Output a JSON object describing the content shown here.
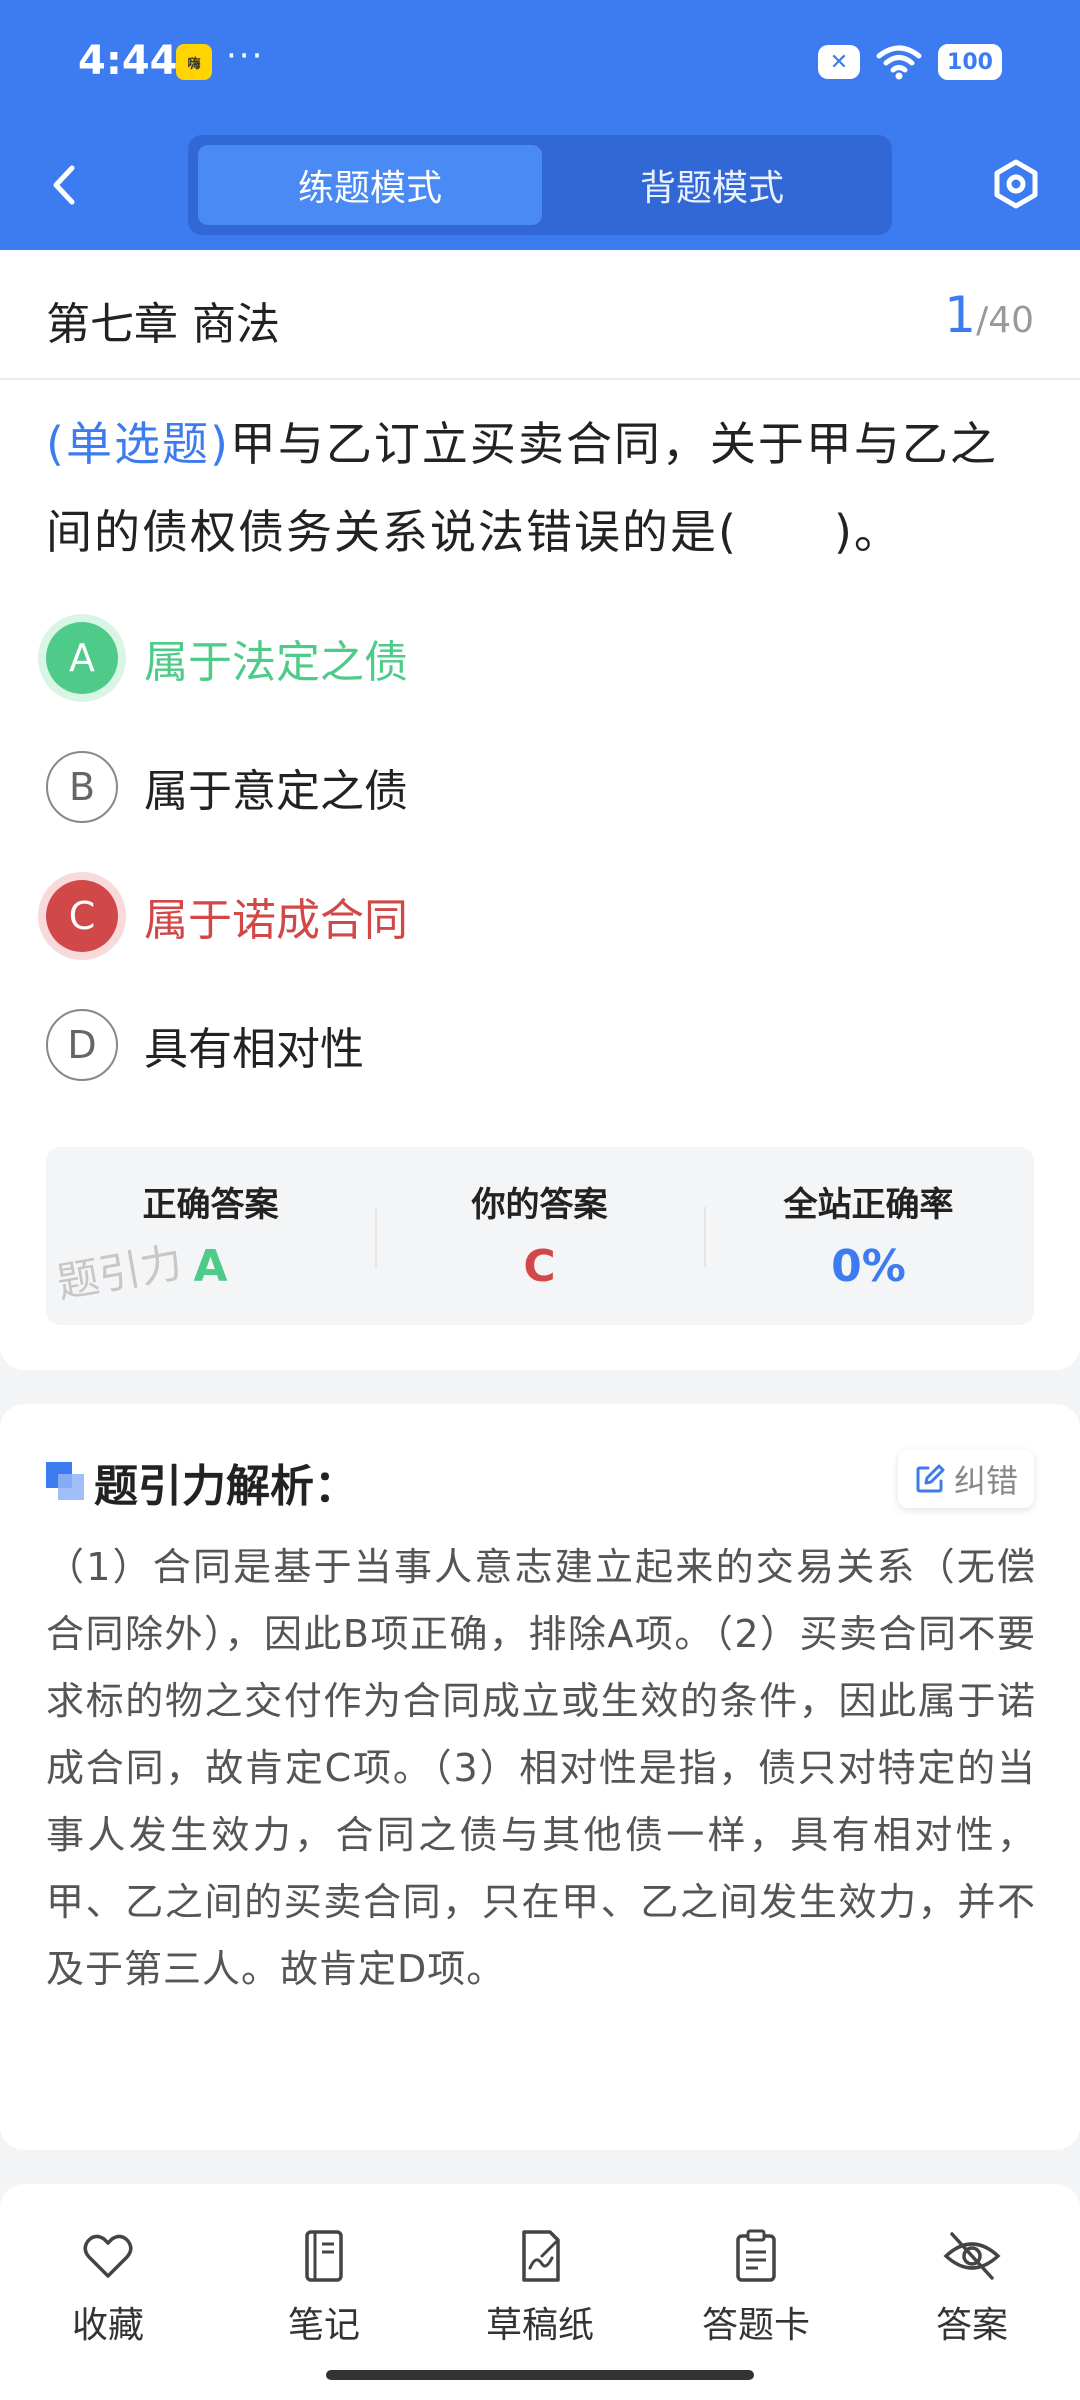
{
  "status_bar": {
    "time": "4:44",
    "app_badge": "嗨",
    "dots": "···",
    "battery": "100"
  },
  "header": {
    "tabs": [
      {
        "label": "练题模式",
        "active": true
      },
      {
        "label": "背题模式",
        "active": false
      }
    ],
    "accent_color": "#3d7cf0"
  },
  "chapter": {
    "title": "第七章 商法",
    "current": "1",
    "total": "/40"
  },
  "question": {
    "type": "(单选题)",
    "text": "甲与乙订立买卖合同，关于甲与乙之间的债权债务关系说法错误的是(　　)。"
  },
  "options": [
    {
      "letter": "A",
      "text": "属于法定之债",
      "state": "correct"
    },
    {
      "letter": "B",
      "text": "属于意定之债",
      "state": "normal"
    },
    {
      "letter": "C",
      "text": "属于诺成合同",
      "state": "wrong"
    },
    {
      "letter": "D",
      "text": "具有相对性",
      "state": "normal"
    }
  ],
  "result": {
    "correct_label": "正确答案",
    "correct_value": "A",
    "yours_label": "你的答案",
    "yours_value": "C",
    "rate_label": "全站正确率",
    "rate_value": "0%",
    "watermark": "题引力",
    "colors": {
      "correct": "#4ecb88",
      "wrong": "#d14848",
      "rate": "#3d7cf0"
    }
  },
  "analysis": {
    "title": "题引力解析：",
    "report_label": "纠错",
    "text": "（1）合同是基于当事人意志建立起来的交易关系（无偿合同除外），因此B项正确，排除A项。（2）买卖合同不要求标的物之交付作为合同成立或生效的条件，因此属于诺成合同，故肯定C项。（3）相对性是指，债只对特定的当事人发生效力，合同之债与其他债一样，具有相对性，甲、乙之间的买卖合同，只在甲、乙之间发生效力，并不及于第三人。故肯定D项。"
  },
  "toolbar": [
    {
      "label": "收藏",
      "icon": "heart-icon"
    },
    {
      "label": "笔记",
      "icon": "notebook-icon"
    },
    {
      "label": "草稿纸",
      "icon": "draft-paper-icon"
    },
    {
      "label": "答题卡",
      "icon": "answer-sheet-icon"
    },
    {
      "label": "答案",
      "icon": "eye-off-icon"
    }
  ]
}
